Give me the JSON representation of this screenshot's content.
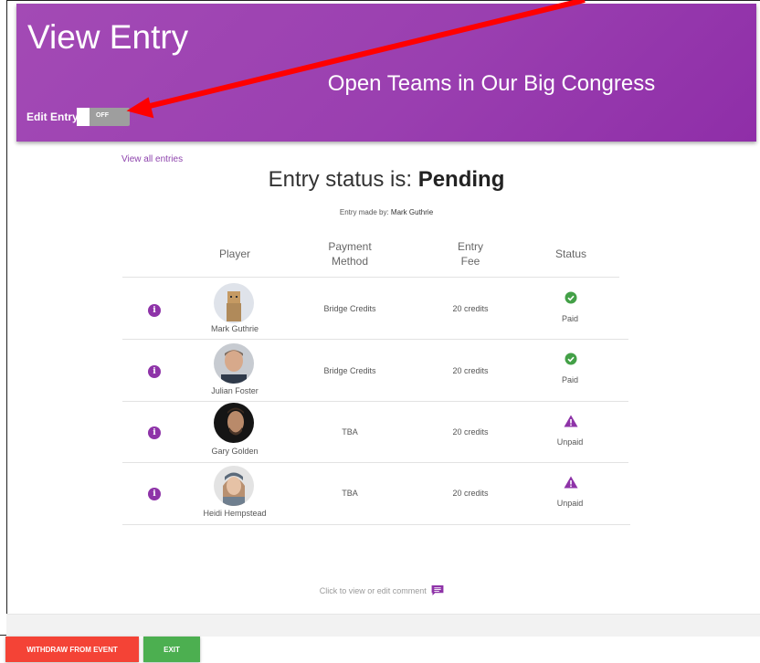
{
  "header": {
    "page_title": "View Entry",
    "event_name": "Open Teams in Our Big Congress",
    "edit_label": "Edit Entry",
    "toggle_state": "OFF"
  },
  "links": {
    "view_all": "View all entries"
  },
  "entry": {
    "status_prefix": "Entry status is:",
    "status_value": "Pending",
    "made_by_prefix": "Entry made by:",
    "made_by_name": "Mark Guthrie"
  },
  "table": {
    "headers": {
      "player": "Player",
      "payment_1": "Payment",
      "payment_2": "Method",
      "fee_1": "Entry",
      "fee_2": "Fee",
      "status": "Status"
    },
    "rows": [
      {
        "name": "Mark Guthrie",
        "payment": "Bridge Credits",
        "fee": "20 credits",
        "status": "Paid",
        "status_icon": "check-circle-icon"
      },
      {
        "name": "Julian Foster",
        "payment": "Bridge Credits",
        "fee": "20 credits",
        "status": "Paid",
        "status_icon": "check-circle-icon"
      },
      {
        "name": "Gary Golden",
        "payment": "TBA",
        "fee": "20 credits",
        "status": "Unpaid",
        "status_icon": "warning-icon"
      },
      {
        "name": "Heidi Hempstead",
        "payment": "TBA",
        "fee": "20 credits",
        "status": "Unpaid",
        "status_icon": "warning-icon"
      }
    ]
  },
  "comment": {
    "label": "Click to view or edit comment"
  },
  "buttons": {
    "withdraw": "WITHDRAW FROM EVENT",
    "exit": "EXIT"
  },
  "colors": {
    "header": "#9c3fb1",
    "accent": "#8e33a8",
    "paid": "#43a047",
    "withdraw": "#f44336",
    "exit": "#4caf50",
    "annotation_arrow": "#ff0000"
  }
}
